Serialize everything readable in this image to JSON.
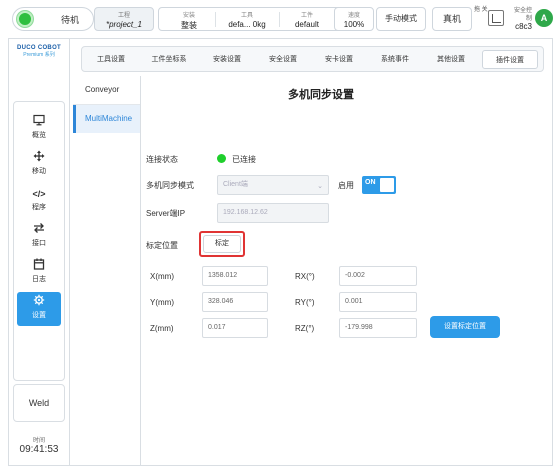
{
  "topbar": {
    "power_label": "待机",
    "project_small": "工程",
    "project_name": "*project_1",
    "install_small": "安装",
    "install_value": "整装",
    "tool_small": "工具",
    "tool_value": "defa... 0kg",
    "workpiece_small": "工件",
    "workpiece_value": "default",
    "speed_small": "速度",
    "speed_value": "100%",
    "mode_label": "手动模式",
    "real_label": "真机",
    "extra_label": "拖 关",
    "safety_small": "安全控 制",
    "safety_value": "c8c3",
    "avatar_letter": "A"
  },
  "sidebar": {
    "logo_line1": "DUCO COBOT",
    "logo_line2": "Premium 系列",
    "items": [
      {
        "label": "概览",
        "icon": "monitor-icon"
      },
      {
        "label": "移动",
        "icon": "move-icon"
      },
      {
        "label": "程序",
        "icon": "code-icon"
      },
      {
        "label": "接口",
        "icon": "interface-icon"
      },
      {
        "label": "日志",
        "icon": "calendar-icon"
      },
      {
        "label": "设置",
        "icon": "gear-icon"
      }
    ],
    "weld_label": "Weld",
    "time_small": "时间",
    "time_value": "09:41:53"
  },
  "tabs": [
    "工具设置",
    "工件坐标系",
    "安装设置",
    "安全设置",
    "安卡设置",
    "系统事件",
    "其他设置",
    "插件设置"
  ],
  "sublist": [
    "Conveyor",
    "MultiMachine"
  ],
  "main": {
    "title": "多机同步设置",
    "conn_label": "连接状态",
    "conn_status": "已连接",
    "mode_label": "多机同步模式",
    "mode_value": "Client端",
    "enable_label": "启用",
    "toggle_text": "ON",
    "server_label": "Server端IP",
    "server_value": "192.168.12.62",
    "calib_label": "标定位置",
    "calib_button": "标定",
    "x_label": "X(mm)",
    "x_value": "1358.012",
    "y_label": "Y(mm)",
    "y_value": "328.046",
    "z_label": "Z(mm)",
    "z_value": "0.017",
    "rx_label": "RX(°)",
    "rx_value": "-0.002",
    "ry_label": "RY(°)",
    "ry_value": "0.001",
    "rz_label": "RZ(°)",
    "rz_value": "-179.998",
    "set_button": "设置标定位置"
  },
  "colors": {
    "accent": "#2d9be8",
    "status_green": "#1fcf2c",
    "highlight_red": "#e03434"
  }
}
